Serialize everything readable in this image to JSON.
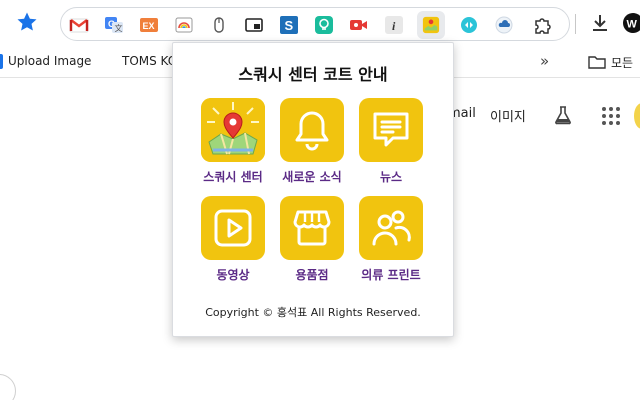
{
  "toolbar": {
    "extensions": [
      {
        "icon": "gmail-icon",
        "active": false
      },
      {
        "icon": "google-translate-icon",
        "active": false
      },
      {
        "icon": "ex-extension-icon",
        "active": false
      },
      {
        "icon": "rainbow-window-icon",
        "active": false
      },
      {
        "icon": "mouse-icon",
        "active": false
      },
      {
        "icon": "picture-in-picture-icon",
        "active": false
      },
      {
        "icon": "s-extension-icon",
        "active": false
      },
      {
        "icon": "bulb-extension-icon",
        "active": false
      },
      {
        "icon": "video-record-icon",
        "active": false
      },
      {
        "icon": "info-icon",
        "active": false
      },
      {
        "icon": "squash-center-extension-icon",
        "active": true
      },
      {
        "icon": "arrows-extension-icon",
        "active": false
      },
      {
        "icon": "cloud-extension-icon",
        "active": false
      },
      {
        "icon": "puzzle-icon",
        "active": false
      }
    ]
  },
  "bookmarks": {
    "items": [
      {
        "label": "Upload Image"
      },
      {
        "label": "TOMS KO"
      }
    ],
    "all_label": "모든"
  },
  "page": {
    "gmail_label": "mail",
    "images_label": "이미지"
  },
  "popup": {
    "title": "스쿼시 센터 코트 안내",
    "tiles": [
      {
        "label": "스쿼시 센터",
        "icon": "map-pin-icon"
      },
      {
        "label": "새로운 소식",
        "icon": "bell-icon"
      },
      {
        "label": "뉴스",
        "icon": "message-icon"
      },
      {
        "label": "동영상",
        "icon": "play-icon"
      },
      {
        "label": "용품점",
        "icon": "store-icon"
      },
      {
        "label": "의류 프린트",
        "icon": "people-icon"
      }
    ],
    "copyright": "Copyright © 홍석표 All Rights Reserved."
  },
  "colors": {
    "tile_yellow": "#f1c40f",
    "label_purple": "#5b2a86",
    "star_blue": "#1a73e8"
  }
}
